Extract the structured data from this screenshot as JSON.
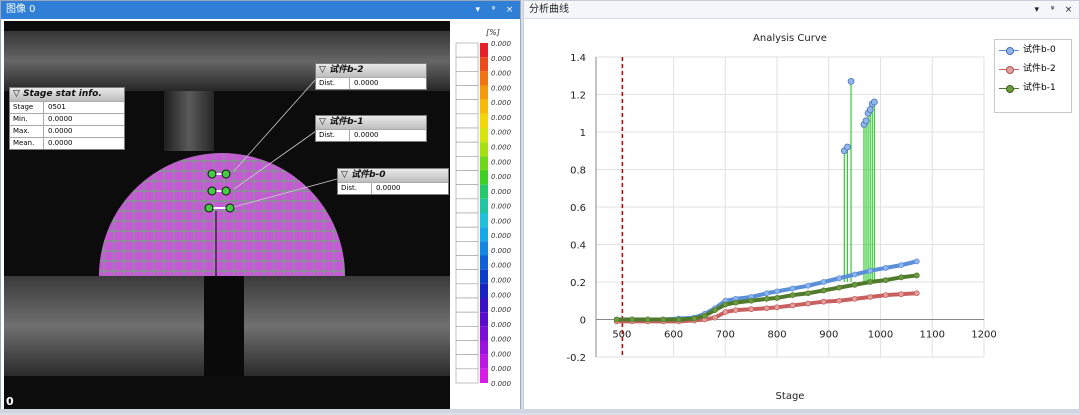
{
  "left_panel": {
    "title": "图像 0",
    "buttons": [
      "▾",
      "ᵠ",
      "×"
    ],
    "frame_index": "0",
    "stage_info": {
      "title": "Stage stat info.",
      "rows": [
        {
          "label": "Stage",
          "value": "0501"
        },
        {
          "label": "Min.",
          "value": "0.0000"
        },
        {
          "label": "Max.",
          "value": "0.0000"
        },
        {
          "label": "Mean.",
          "value": "0.0000"
        }
      ]
    },
    "probes": [
      {
        "name": "试件b-2",
        "label": "Dist.",
        "value": "0.0000"
      },
      {
        "name": "试件b-1",
        "label": "Dist.",
        "value": "0.0000"
      },
      {
        "name": "试件b-0",
        "label": "Dist.",
        "value": "0.0000"
      }
    ],
    "colorbar": {
      "unit": "[%]",
      "labels": [
        "0.000",
        "0.000",
        "0.000",
        "0.000",
        "0.000",
        "0.000",
        "0.000",
        "0.000",
        "0.000",
        "0.000",
        "0.000",
        "0.000",
        "0.000",
        "0.000",
        "0.000",
        "0.000",
        "0.000",
        "0.000",
        "0.000",
        "0.000",
        "0.000",
        "0.000",
        "0.000",
        "0.000"
      ],
      "colors": [
        "#e5202a",
        "#ea4a1c",
        "#f07414",
        "#f59a0c",
        "#f7bb08",
        "#f2d70a",
        "#d6e40e",
        "#a6e012",
        "#6fd81a",
        "#3fd026",
        "#25c86a",
        "#22c4a4",
        "#1fc0d8",
        "#17a8e8",
        "#1286e0",
        "#0e60d4",
        "#0a3ec8",
        "#1822c0",
        "#3a10c4",
        "#5a0ccc",
        "#7a0ed4",
        "#9a12dc",
        "#bc18e2",
        "#d61ce6"
      ]
    }
  },
  "right_panel": {
    "title": "分析曲线",
    "buttons": [
      "▾",
      "ᵠ",
      "×"
    ]
  },
  "colors": {
    "accent": "#2f7fd7",
    "series0": "#5b8fd8",
    "series1": "#c86060",
    "series2": "#4f7a2c",
    "spike": "#33cc33",
    "marker_line": "#cc0000"
  },
  "chart_data": {
    "type": "line",
    "title": "Analysis Curve",
    "xlabel": "Stage",
    "ylabel": "",
    "xlim": [
      450,
      1200
    ],
    "ylim": [
      -0.2,
      1.4
    ],
    "xticks": [
      500,
      600,
      700,
      800,
      900,
      1000,
      1100,
      1200
    ],
    "yticks": [
      -0.2,
      0,
      0.2,
      0.4,
      0.6,
      0.8,
      1,
      1.2,
      1.4
    ],
    "ytick_labels": [
      "-0.2",
      "0",
      "0.2",
      "0.4",
      "0.6",
      "0.8",
      "1",
      "1.2",
      "1.4"
    ],
    "grid": true,
    "legend_position": "top-right",
    "marker_x": 501,
    "series": [
      {
        "name": "试件b-0",
        "x": [
          490,
          520,
          550,
          580,
          610,
          640,
          660,
          680,
          700,
          720,
          750,
          780,
          800,
          830,
          860,
          890,
          920,
          950,
          980,
          1010,
          1040,
          1070
        ],
        "y": [
          0,
          0,
          0,
          0,
          0.005,
          0.01,
          0.03,
          0.06,
          0.1,
          0.11,
          0.12,
          0.14,
          0.15,
          0.165,
          0.18,
          0.2,
          0.22,
          0.24,
          0.26,
          0.275,
          0.29,
          0.31
        ]
      },
      {
        "name": "试件b-2",
        "x": [
          490,
          520,
          550,
          580,
          610,
          640,
          660,
          680,
          700,
          720,
          750,
          780,
          800,
          830,
          860,
          890,
          920,
          950,
          980,
          1010,
          1040,
          1070
        ],
        "y": [
          -0.01,
          -0.01,
          -0.01,
          -0.01,
          -0.01,
          -0.005,
          0,
          0.01,
          0.04,
          0.05,
          0.055,
          0.06,
          0.065,
          0.075,
          0.085,
          0.095,
          0.1,
          0.11,
          0.12,
          0.13,
          0.135,
          0.14
        ]
      },
      {
        "name": "试件b-1",
        "x": [
          490,
          520,
          550,
          580,
          610,
          640,
          660,
          680,
          700,
          720,
          750,
          780,
          800,
          830,
          860,
          890,
          920,
          950,
          980,
          1010,
          1040,
          1070
        ],
        "y": [
          0,
          0,
          0,
          0,
          0,
          0.005,
          0.02,
          0.05,
          0.08,
          0.09,
          0.1,
          0.11,
          0.115,
          0.13,
          0.14,
          0.155,
          0.17,
          0.185,
          0.2,
          0.21,
          0.225,
          0.235
        ]
      }
    ],
    "spikes": {
      "series": "试件b-0",
      "x": [
        930,
        936,
        943,
        968,
        972,
        976,
        980,
        984,
        988
      ],
      "y": [
        0.9,
        0.92,
        1.27,
        1.04,
        1.06,
        1.1,
        1.12,
        1.15,
        1.16
      ]
    }
  }
}
